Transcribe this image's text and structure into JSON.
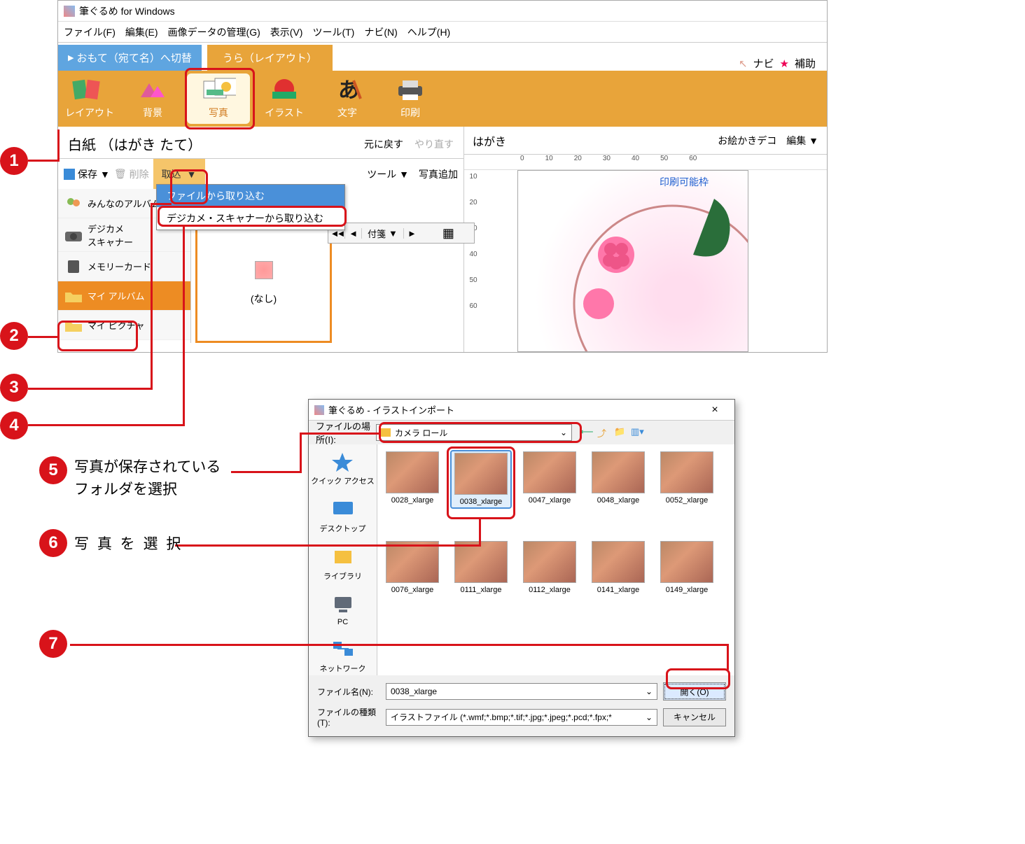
{
  "app": {
    "title": "筆ぐるめ for Windows",
    "menus": [
      "ファイル(F)",
      "編集(E)",
      "画像データの管理(G)",
      "表示(V)",
      "ツール(T)",
      "ナビ(N)",
      "ヘルプ(H)"
    ]
  },
  "tabs": {
    "switch": "おもて（宛て名）へ切替",
    "layout": "うら（レイアウト）",
    "navi": "ナビ",
    "assist": "補助"
  },
  "toolbar": [
    {
      "label": "レイアウト"
    },
    {
      "label": "背景"
    },
    {
      "label": "写真",
      "active": true
    },
    {
      "label": "イラスト"
    },
    {
      "label": "文字"
    },
    {
      "label": "印刷"
    }
  ],
  "doc": {
    "title": "白紙 （はがき たて）",
    "undo": "元に戻す",
    "redo": "やり直す"
  },
  "actionbar": {
    "save": "保存",
    "save_drop": "▼",
    "delete": "削除",
    "import": "取込",
    "import_drop": "▼",
    "tool": "ツール",
    "tool_drop": "▼",
    "addphoto": "写真追加"
  },
  "import_menu": {
    "file": "ファイルから取り込む",
    "scanner": "デジカメ・スキャナーから取り込む"
  },
  "subbar": {
    "nav_prev2": "◄◄",
    "nav_prev": "◄",
    "sticky": "付箋",
    "sticky_drop": "▼",
    "nav_next": "►",
    "grid": "▦"
  },
  "folders": [
    {
      "label": "みんなのアルバム",
      "icon": "group"
    },
    {
      "label": "デジカメ\nスキャナー",
      "icon": "camera"
    },
    {
      "label": "メモリーカード",
      "icon": "sd"
    },
    {
      "label": "マイ アルバム",
      "icon": "folder",
      "selected": true
    },
    {
      "label": "マイ ピクチャ",
      "icon": "folder"
    }
  ],
  "thumb_placeholder": "(なし)",
  "right": {
    "title": "はがき",
    "deco": "お絵かきデコ",
    "edit": "編集",
    "edit_drop": "▼",
    "print_area": "印刷可能枠"
  },
  "ruler_h": [
    "0",
    "10",
    "20",
    "30",
    "40",
    "50",
    "60"
  ],
  "ruler_v": [
    "10",
    "20",
    "30",
    "40",
    "50",
    "60"
  ],
  "dialog": {
    "title": "筆ぐるめ - イラストインポート",
    "close": "×",
    "location_label": "ファイルの場所(I):",
    "location_value": "カメラ ロール",
    "sidebar": [
      {
        "label": "クイック アクセス",
        "color": "#3a8bd8"
      },
      {
        "label": "デスクトップ",
        "color": "#3a8bd8"
      },
      {
        "label": "ライブラリ",
        "color": "#e8a43a"
      },
      {
        "label": "PC",
        "color": "#606a78"
      },
      {
        "label": "ネットワーク",
        "color": "#3a8bd8"
      }
    ],
    "files_row1": [
      "0028_xlarge",
      "0038_xlarge",
      "0047_xlarge",
      "0048_xlarge",
      "0052_xlarge"
    ],
    "files_row2": [
      "0076_xlarge",
      "0111_xlarge",
      "0112_xlarge",
      "0141_xlarge",
      "0149_xlarge"
    ],
    "selected_file": "0038_xlarge",
    "filename_label": "ファイル名(N):",
    "filename_value": "0038_xlarge",
    "filetype_label": "ファイルの種類(T):",
    "filetype_value": "イラストファイル (*.wmf;*.bmp;*.tif;*.jpg;*.jpeg;*.pcd;*.fpx;*",
    "open": "開く(O)",
    "cancel": "キャンセル"
  },
  "callouts": {
    "c1": "1",
    "c2": "2",
    "c3": "3",
    "c4": "4",
    "c5": "5",
    "c6": "6",
    "c7": "7",
    "t5": "写真が保存されているフォルダを選択",
    "t6": "写 真 を 選 択"
  }
}
